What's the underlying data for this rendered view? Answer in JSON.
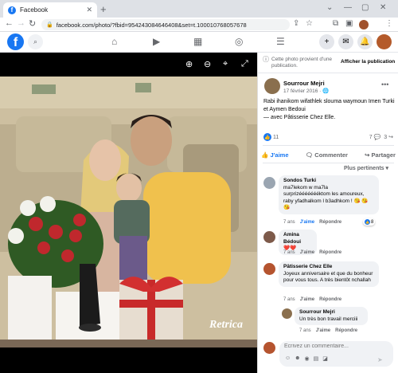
{
  "browser": {
    "tab_title": "Facebook",
    "tab_close": "✕",
    "new_tab": "+",
    "url": "facebook.com/photo/?fbid=954243084646408&set=t.100010768057678",
    "window_controls": [
      "⌄",
      "—",
      "▢",
      "✕"
    ]
  },
  "fb_header": {
    "logo": "f",
    "nav_icons": [
      "home-icon",
      "watch-icon",
      "marketplace-icon",
      "groups-icon",
      "menu-icon"
    ],
    "right_buttons": [
      "create-icon",
      "messenger-icon",
      "notifications-icon",
      "profile-avatar"
    ]
  },
  "photo": {
    "watermark": "Retrica"
  },
  "panel": {
    "notice": "Cette photo provient d'une publication.",
    "show_publication": "Afficher la publication",
    "author": "Sourrour Mejri",
    "date": "17 février 2016 · ",
    "caption": "Rabi ihanikom wifathlek slouma waymoun Imen Turki et Aymen Bedoui",
    "with_line": "— avec Pâtisserie Chez Elle.",
    "like_count": "11",
    "comment_count": "7",
    "share_count": "3",
    "actions": {
      "like": "J'aime",
      "comment": "Commenter",
      "share": "Partager"
    },
    "sort_label": "Plus pertinents ▾",
    "comments": [
      {
        "name": "Sondos Turki",
        "text": "ma7lekom w ma7la surprizéééééééktom les amoureux, raby yfadhalkom l b3adhkom ! 😘 😘 😘",
        "time": "7 ans",
        "like": "J'aime",
        "reply": "Répondre",
        "reactions": "8"
      },
      {
        "name": "Amina Bédoui",
        "text": "❤️❤️",
        "time": "7 ans",
        "like": "J'aime",
        "reply": "Répondre",
        "reactions": ""
      },
      {
        "name": "Pâtisserie Chez Elle",
        "text": "Joyeux anniversaire et que du bonheur pour vous tous. A très bientôt nchallah",
        "time": "7 ans",
        "like": "J'aime",
        "reply": "Répondre",
        "reactions": ""
      },
      {
        "name": "Sourrour Mejri",
        "text": "Un très bon travail merciii",
        "time": "7 ans",
        "like": "J'aime",
        "reply": "Répondre",
        "reactions": ""
      }
    ],
    "comment_placeholder": "Écrivez un commentaire..."
  }
}
